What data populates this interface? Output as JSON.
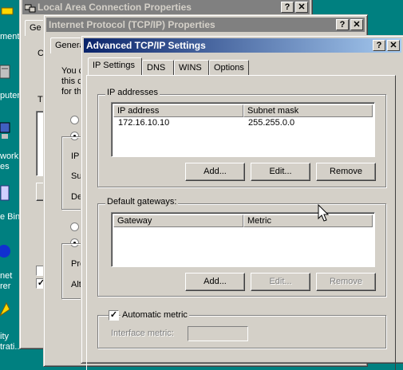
{
  "desktop": {
    "icon_labels": [
      "ment",
      "puter",
      "work",
      "es",
      "e Bin",
      "net",
      "rer",
      "ity",
      "trati..."
    ]
  },
  "win_lan": {
    "title": "Local Area Connection Properties",
    "tab_fragment": "Ge",
    "fragments": [
      "C",
      "T"
    ]
  },
  "win_tcpip": {
    "title": "Internet Protocol (TCP/IP) Properties",
    "tab_label": "Genera",
    "fragments": [
      "You c",
      "this c",
      "for th",
      "IP",
      "Su",
      "De",
      "Pre",
      "Alt"
    ]
  },
  "advanced": {
    "title": "Advanced TCP/IP Settings",
    "help_glyph": "?",
    "close_glyph": "✕",
    "tabs": [
      "IP Settings",
      "DNS",
      "WINS",
      "Options"
    ],
    "ip_group": {
      "label": "IP addresses",
      "col_ip": "IP address",
      "col_mask": "Subnet mask",
      "rows": [
        {
          "ip": "172.16.10.10",
          "mask": "255.255.0.0"
        }
      ],
      "add": "Add...",
      "edit": "Edit...",
      "remove": "Remove"
    },
    "gw_group": {
      "label": "Default gateways:",
      "col_gw": "Gateway",
      "col_metric": "Metric",
      "add": "Add...",
      "edit": "Edit...",
      "remove": "Remove"
    },
    "auto_metric": {
      "label": "Automatic metric",
      "checked": true
    },
    "interface_metric": {
      "label": "Interface metric:",
      "value": ""
    }
  }
}
